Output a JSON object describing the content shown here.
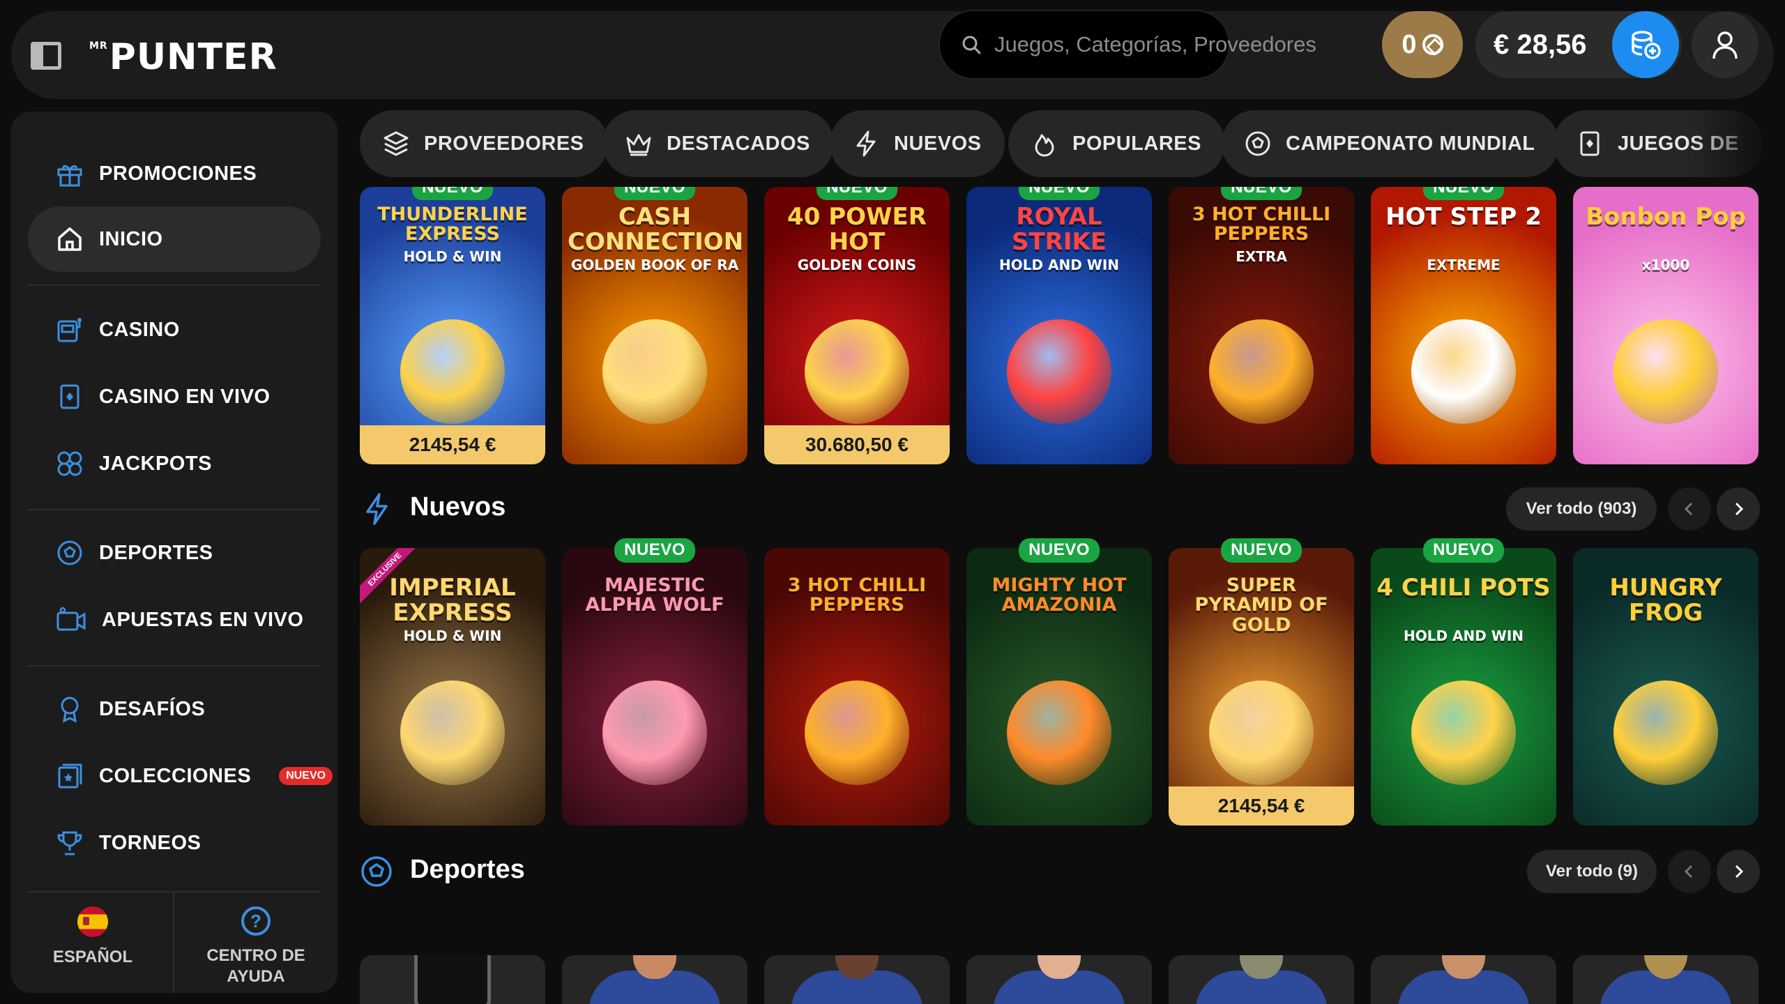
{
  "header": {
    "logo_prefix": "MR",
    "logo_text": "PUNTER",
    "search_placeholder": "Juegos, Categorías, Proveedores",
    "points": "0",
    "balance": "€ 28,56"
  },
  "sidebar": {
    "items": [
      {
        "label": "PROMOCIONES",
        "icon": "gift-icon"
      },
      {
        "label": "INICIO",
        "icon": "home-icon",
        "active": true
      },
      {
        "label": "CASINO",
        "icon": "slot-machine-icon"
      },
      {
        "label": "CASINO EN VIVO",
        "icon": "live-card-icon"
      },
      {
        "label": "JACKPOTS",
        "icon": "jackpot-icon"
      },
      {
        "label": "DEPORTES",
        "icon": "football-icon"
      },
      {
        "label": "APUESTAS EN VIVO",
        "icon": "video-camera-icon"
      },
      {
        "label": "DESAFÍOS",
        "icon": "badge-icon"
      },
      {
        "label": "COLECCIONES",
        "icon": "collection-icon",
        "badge": "NUEVO"
      },
      {
        "label": "TORNEOS",
        "icon": "trophy-icon"
      }
    ],
    "language": "ESPAÑOL",
    "help": "CENTRO DE AYUDA"
  },
  "categories": [
    {
      "label": "PROVEEDORES",
      "icon": "layers-icon"
    },
    {
      "label": "DESTACADOS",
      "icon": "crown-icon"
    },
    {
      "label": "NUEVOS",
      "icon": "lightning-icon"
    },
    {
      "label": "POPULARES",
      "icon": "flame-icon"
    },
    {
      "label": "CAMPEONATO MUNDIAL",
      "icon": "football-icon"
    },
    {
      "label": "JUEGOS DE",
      "icon": "live-card-icon"
    }
  ],
  "featured_games": [
    {
      "title": "THUNDERLINE EXPRESS",
      "subtitle": "HOLD & WIN",
      "tag": "NUEVO",
      "jackpot": "2145,54 €",
      "bg1": "#1b3f9a",
      "bg2": "#5aa0ff",
      "title_color": "#ffd24a"
    },
    {
      "title": "CASH CONNECTION",
      "subtitle": "GOLDEN BOOK OF RA",
      "tag": "NUEVO",
      "jackpot": "",
      "bg1": "#8a2a00",
      "bg2": "#ff9a00",
      "title_color": "#ffe07a"
    },
    {
      "title": "40 POWER HOT",
      "subtitle": "GOLDEN COINS",
      "tag": "NUEVO",
      "jackpot": "30.680,50 €",
      "bg1": "#6a0000",
      "bg2": "#d81a1a",
      "title_color": "#ffd24a"
    },
    {
      "title": "ROYAL STRIKE",
      "subtitle": "HOLD AND WIN",
      "tag": "NUEVO",
      "jackpot": "",
      "bg1": "#0b2a7a",
      "bg2": "#2f6fe0",
      "title_color": "#ff4444"
    },
    {
      "title": "3 HOT CHILLI PEPPERS",
      "subtitle": "EXTRA",
      "tag": "NUEVO",
      "jackpot": "",
      "bg1": "#3a0a05",
      "bg2": "#8a1a0a",
      "title_color": "#ffb02a"
    },
    {
      "title": "HOT STEP 2",
      "subtitle": "EXTREME",
      "tag": "NUEVO",
      "jackpot": "",
      "bg1": "#b21800",
      "bg2": "#ffb000",
      "title_color": "#ffffff"
    },
    {
      "title": "Bonbon Pop",
      "subtitle": "x1000",
      "tag": "",
      "jackpot": "",
      "bg1": "#e66ec8",
      "bg2": "#ffc0ea",
      "title_color": "#ffcf3a"
    }
  ],
  "sections": {
    "nuevos": {
      "title": "Nuevos",
      "view_all": "Ver todo (903)"
    },
    "deportes": {
      "title": "Deportes",
      "view_all": "Ver todo (9)"
    }
  },
  "new_games": [
    {
      "title": "IMPERIAL EXPRESS",
      "subtitle": "HOLD & WIN",
      "tag": "",
      "ribbon": "EXCLUSIVE",
      "jackpot": "",
      "bg1": "#2a1a0c",
      "bg2": "#9a7a4a",
      "title_color": "#ffd870"
    },
    {
      "title": "MAJESTIC ALPHA WOLF",
      "subtitle": "",
      "tag": "NUEVO",
      "ribbon": "",
      "jackpot": "",
      "bg1": "#2a0810",
      "bg2": "#8a2040",
      "title_color": "#ff9ab0"
    },
    {
      "title": "3 HOT CHILLI PEPPERS",
      "subtitle": "",
      "tag": "",
      "ribbon": "",
      "jackpot": "",
      "bg1": "#4a0805",
      "bg2": "#b81a0a",
      "title_color": "#ffb02a"
    },
    {
      "title": "MIGHTY HOT AMAZONIA",
      "subtitle": "",
      "tag": "NUEVO",
      "ribbon": "",
      "jackpot": "",
      "bg1": "#0c2a12",
      "bg2": "#2a5a2a",
      "title_color": "#ff8a2a"
    },
    {
      "title": "SUPER PYRAMID OF GOLD",
      "subtitle": "",
      "tag": "NUEVO",
      "ribbon": "",
      "jackpot": "2145,54 €",
      "bg1": "#5a1a08",
      "bg2": "#f0a030",
      "title_color": "#ffd870"
    },
    {
      "title": "4 CHILI POTS",
      "subtitle": "HOLD AND WIN",
      "tag": "NUEVO",
      "ribbon": "",
      "jackpot": "",
      "bg1": "#0a4a1a",
      "bg2": "#1aa040",
      "title_color": "#ffd24a"
    },
    {
      "title": "HUNGRY FROG",
      "subtitle": "",
      "tag": "",
      "ribbon": "",
      "jackpot": "",
      "bg1": "#0a2a28",
      "bg2": "#1a5a50",
      "title_color": "#ffcf3a"
    }
  ],
  "colors": {
    "accent": "#1d8cf0",
    "gold": "#9d7b49",
    "new_badge": "#1aa542",
    "jackpot": "#f3c96b",
    "promo_badge": "#e52b2b"
  }
}
